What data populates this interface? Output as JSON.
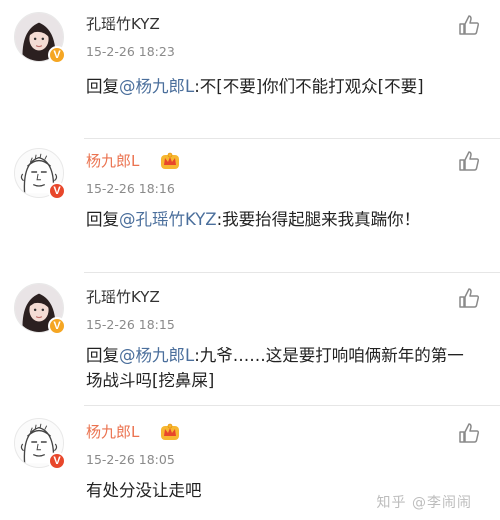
{
  "colors": {
    "mention": "#4b6f9c",
    "username_vip": "#eb7350",
    "username_normal": "#333333",
    "badge_yellow": "#f5a623",
    "badge_orange": "#e8472b",
    "timestamp": "#8a8a8a"
  },
  "comments": [
    {
      "username": "孔瑶竹KYZ",
      "vip": false,
      "badge": "V",
      "timestamp": "15-2-26 18:23",
      "reply_prefix": "回复",
      "mention": "@杨九郎L",
      "text": ":不[不要]你们不能打观众[不要]",
      "avatar_icon": "girl-avatar-icon",
      "like_icon": "thumbs-up-icon"
    },
    {
      "username": "杨九郎L",
      "vip": true,
      "badge": "V",
      "timestamp": "15-2-26 18:16",
      "reply_prefix": "回复",
      "mention": "@孔瑶竹KYZ",
      "text": ":我要抬得起腿来我真踹你！",
      "avatar_icon": "cartoon-face-avatar-icon",
      "like_icon": "thumbs-up-icon"
    },
    {
      "username": "孔瑶竹KYZ",
      "vip": false,
      "badge": "V",
      "timestamp": "15-2-26 18:15",
      "reply_prefix": "回复",
      "mention": "@杨九郎L",
      "text": ":九爷……这是要打响咱俩新年的第一场战斗吗[挖鼻屎]",
      "avatar_icon": "girl-avatar-icon",
      "like_icon": "thumbs-up-icon"
    },
    {
      "username": "杨九郎L",
      "vip": true,
      "badge": "V",
      "timestamp": "15-2-26 18:05",
      "reply_prefix": "",
      "mention": "",
      "text": "有处分没让走吧",
      "avatar_icon": "cartoon-face-avatar-icon",
      "like_icon": "thumbs-up-icon"
    }
  ],
  "watermark": "知乎 @李闹闹"
}
